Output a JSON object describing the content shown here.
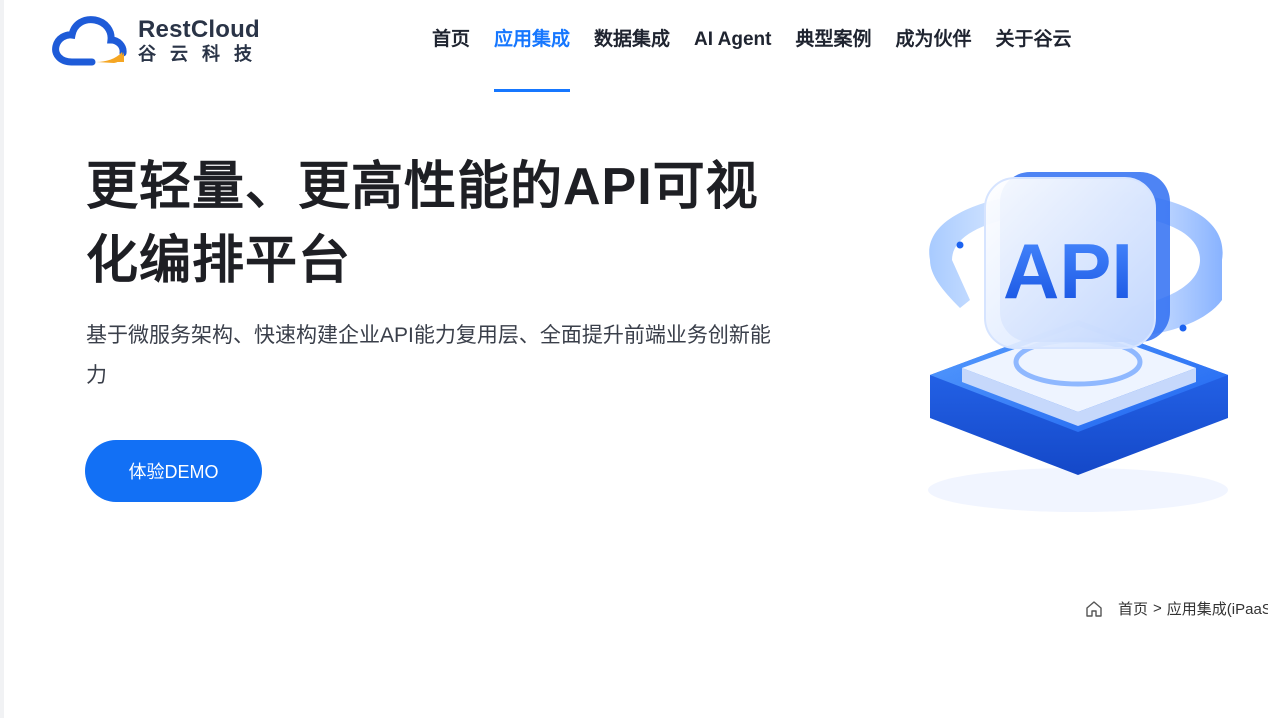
{
  "brand": {
    "name_en": "RestCloud",
    "name_cn": "谷云科技",
    "colors": {
      "cloud_blue": "#1e5bd8",
      "cloud_yellow": "#f5a623",
      "text": "#2a3447"
    }
  },
  "nav": {
    "items": [
      {
        "label": "首页",
        "active": false
      },
      {
        "label": "应用集成",
        "active": true
      },
      {
        "label": "数据集成",
        "active": false
      },
      {
        "label": "AI Agent",
        "active": false
      },
      {
        "label": "典型案例",
        "active": false
      },
      {
        "label": "成为伙伴",
        "active": false
      },
      {
        "label": "关于谷云",
        "active": false
      }
    ],
    "accent_color": "#1677ff"
  },
  "hero": {
    "title": "更轻量、更高性能的API可视化编排平台",
    "subtitle": "基于微服务架构、快速构建企业API能力复用层、全面提升前端业务创新能力",
    "cta_label": "体验DEMO",
    "cta_color": "#1270f5",
    "illustration": {
      "icon": "api-3d-illustration-icon",
      "text": "API"
    }
  },
  "breadcrumb": {
    "icon": "home-icon",
    "items": [
      "首页",
      "应用集成(iPaaS)"
    ],
    "separator": ">"
  }
}
